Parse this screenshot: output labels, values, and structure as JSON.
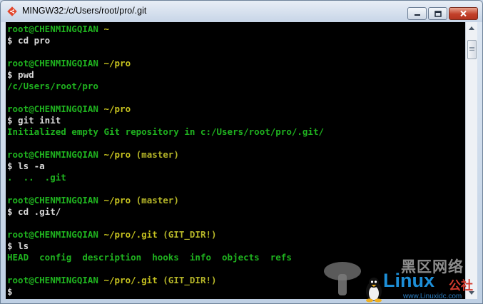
{
  "window": {
    "title": "MINGW32:/c/Users/root/pro/.git"
  },
  "colors": {
    "user_host": "#1fb31f",
    "path": "#c5c11f",
    "branch": "#b5b528",
    "command": "#d9d9d9",
    "output": "#1fb31f",
    "background": "#000000",
    "close_button": "#c2402a"
  },
  "terminal": {
    "lines": [
      {
        "user": "root@CHENMINGQIAN",
        "path": "~",
        "branch": ""
      },
      {
        "cmd": "$ cd pro"
      },
      {
        "blank": ""
      },
      {
        "user": "root@CHENMINGQIAN",
        "path": "~/pro",
        "branch": ""
      },
      {
        "cmd": "$ pwd"
      },
      {
        "out": "/c/Users/root/pro"
      },
      {
        "blank": ""
      },
      {
        "user": "root@CHENMINGQIAN",
        "path": "~/pro",
        "branch": ""
      },
      {
        "cmd": "$ git init"
      },
      {
        "out": "Initialized empty Git repository in c:/Users/root/pro/.git/"
      },
      {
        "blank": ""
      },
      {
        "user": "root@CHENMINGQIAN",
        "path": "~/pro",
        "branch": "(master)"
      },
      {
        "cmd": "$ ls -a"
      },
      {
        "out": ".  ..  .git"
      },
      {
        "blank": ""
      },
      {
        "user": "root@CHENMINGQIAN",
        "path": "~/pro",
        "branch": "(master)"
      },
      {
        "cmd": "$ cd .git/"
      },
      {
        "blank": ""
      },
      {
        "user": "root@CHENMINGQIAN",
        "path": "~/pro/.git",
        "branch": "(GIT_DIR!)"
      },
      {
        "cmd": "$ ls"
      },
      {
        "out": "HEAD  config  description  hooks  info  objects  refs"
      },
      {
        "blank": ""
      },
      {
        "user": "root@CHENMINGQIAN",
        "path": "~/pro/.git",
        "branch": "(GIT_DIR!)"
      },
      {
        "cmd": "$"
      }
    ]
  },
  "watermark": {
    "cn_title": "黑区网络",
    "brand": "Linux",
    "brand_suffix": "公社",
    "url": "www.Linuxidc.com"
  },
  "icons": {
    "app": "git-diamond-icon",
    "minimize": "minimize-icon",
    "maximize": "maximize-icon",
    "close": "close-icon"
  }
}
